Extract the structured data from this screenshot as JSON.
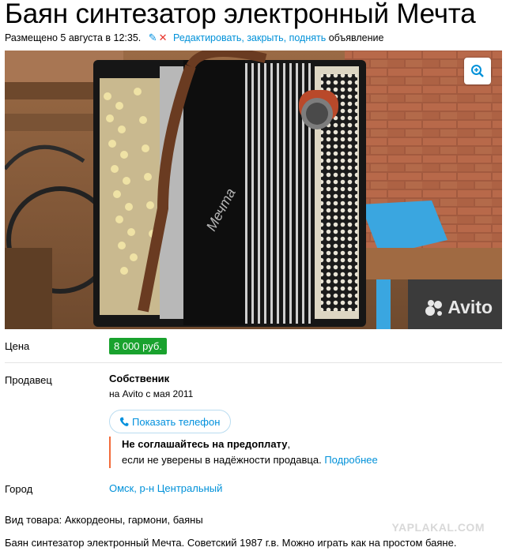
{
  "title": "Баян синтезатор электронный Мечта",
  "meta": {
    "posted": "Размещено 5 августа в 12:35.",
    "edit_links": "Редактировать, закрыть, поднять",
    "suffix": "объявление"
  },
  "photo": {
    "watermark": "Avito",
    "brand_script": "Мечта"
  },
  "price": {
    "label": "Цена",
    "value": "8 000 руб."
  },
  "seller": {
    "label": "Продавец",
    "name": "Собственик",
    "since": "на Avito с мая 2011",
    "phone_button": "Показать телефон"
  },
  "warning": {
    "line1": "Не соглашайтесь на предоплату",
    "line1_comma": ",",
    "line2": "если не уверены в надёжности продавца.",
    "more_link": "Подробнее"
  },
  "city": {
    "label": "Город",
    "value": "Омск, р-н Центральный"
  },
  "kind": "Вид товара: Аккордеоны, гармони, баяны",
  "description": "Баян синтезатор электронный Мечта. Советский 1987 г.в. Можно играть как на простом баяне.",
  "site_watermark": "YAPLAKAL.COM",
  "colors": {
    "link": "#0091d9",
    "price_bg": "#19a22e",
    "warning_border": "#f26b3a"
  }
}
